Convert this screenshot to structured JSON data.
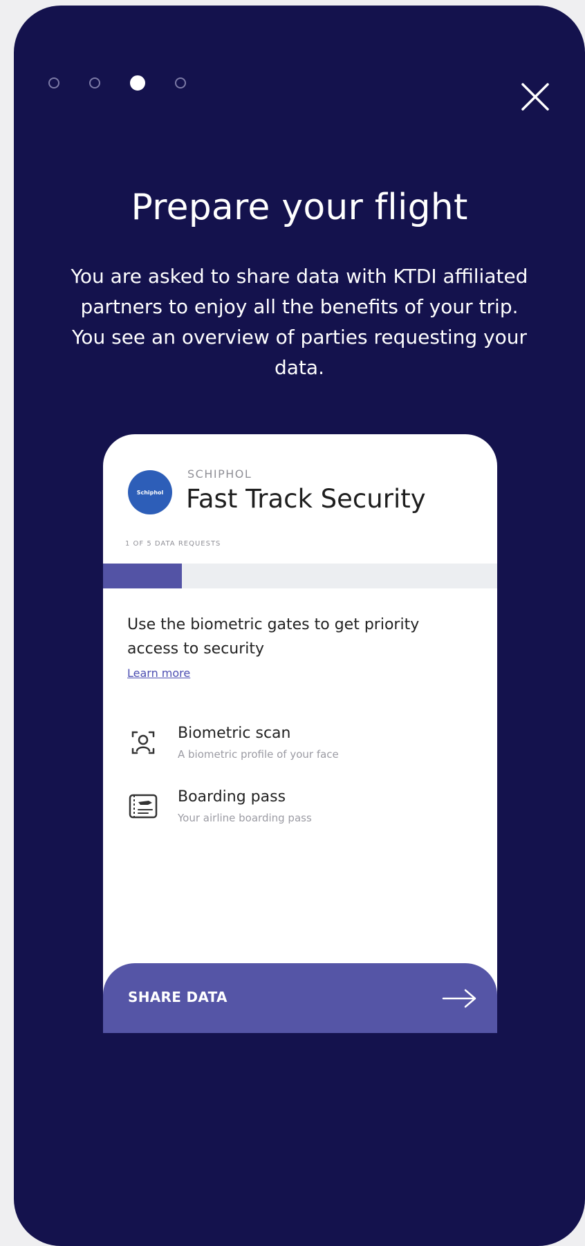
{
  "pagination": {
    "total": 4,
    "active": 3
  },
  "title": "Prepare your flight",
  "subtitle": "You are asked to share data with KTDI affiliated partners to enjoy all the benefits of your trip. You see an overview of parties requesting your data.",
  "card": {
    "logo_text": "Schiphol",
    "provider": "SCHIPHOL",
    "service": "Fast Track Security",
    "request_count": "1 OF 5 DATA REQUESTS",
    "progress": 0.2,
    "description": "Use the biometric gates to get priority access to security",
    "learn_more": "Learn more",
    "items": [
      {
        "title": "Biometric scan",
        "subtitle": "A biometric profile of your face"
      },
      {
        "title": "Boarding pass",
        "subtitle": "Your airline boarding pass"
      }
    ],
    "share_label": "SHARE DATA"
  },
  "colors": {
    "background": "#14124d",
    "accent": "#5555a6",
    "progress_fill": "#5353a5",
    "logo": "#2d5eb8"
  },
  "icons": {
    "close": "close-icon",
    "biometric": "face-scan-icon",
    "boarding": "boarding-pass-icon",
    "arrow": "arrow-right-icon"
  }
}
